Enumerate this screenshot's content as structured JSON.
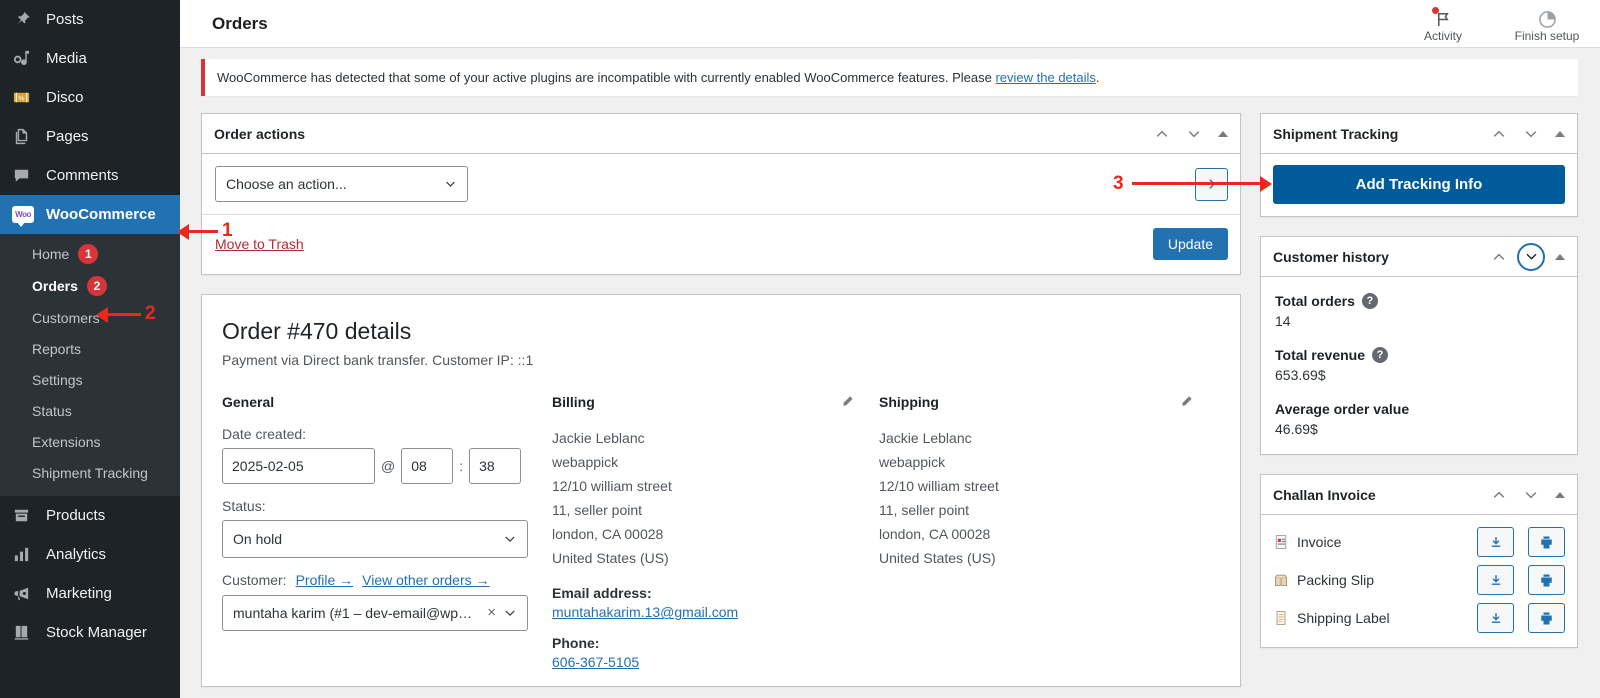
{
  "sidebar": {
    "items": [
      {
        "label": "Posts",
        "icon": "pin-icon",
        "current": false
      },
      {
        "label": "Media",
        "icon": "media-icon",
        "current": false
      },
      {
        "label": "Disco",
        "icon": "ticket-icon",
        "current": false
      },
      {
        "label": "Pages",
        "icon": "pages-icon",
        "current": false
      },
      {
        "label": "Comments",
        "icon": "comment-icon",
        "current": false
      },
      {
        "label": "WooCommerce",
        "icon": "woo-icon",
        "current": true
      },
      {
        "label": "Products",
        "icon": "products-icon",
        "current": false
      },
      {
        "label": "Analytics",
        "icon": "analytics-icon",
        "current": false
      },
      {
        "label": "Marketing",
        "icon": "megaphone-icon",
        "current": false
      },
      {
        "label": "Stock Manager",
        "icon": "stock-icon",
        "current": false
      }
    ],
    "submenu": [
      {
        "label": "Home",
        "count": "1",
        "current": false
      },
      {
        "label": "Orders",
        "count": "2",
        "current": true
      },
      {
        "label": "Customers",
        "count": "",
        "current": false
      },
      {
        "label": "Reports",
        "count": "",
        "current": false
      },
      {
        "label": "Settings",
        "count": "",
        "current": false
      },
      {
        "label": "Status",
        "count": "",
        "current": false
      },
      {
        "label": "Extensions",
        "count": "",
        "current": false
      },
      {
        "label": "Shipment Tracking",
        "count": "",
        "current": false
      }
    ]
  },
  "topbar": {
    "title": "Orders",
    "activity_label": "Activity",
    "finish_setup_label": "Finish setup"
  },
  "notice": {
    "text": "WooCommerce has detected that some of your active plugins are incompatible with currently enabled WooCommerce features. Please ",
    "link": "review the details",
    "suffix": "."
  },
  "order_actions": {
    "title": "Order actions",
    "action_select_value": "Choose an action...",
    "apply_arrow": "›",
    "trash_label": "Move to Trash",
    "update_label": "Update"
  },
  "order_details": {
    "heading": "Order #470 details",
    "subheading": "Payment via Direct bank transfer. Customer IP: ::1",
    "general": {
      "title": "General",
      "date_label": "Date created:",
      "date_value": "2025-02-05",
      "at_symbol": "@",
      "hour_value": "08",
      "colon": ":",
      "minute_value": "38",
      "status_label": "Status:",
      "status_value": "On hold",
      "customer_label": "Customer:",
      "profile_link": "Profile →",
      "other_orders_link": "View other orders →",
      "customer_value": "muntaha karim (#1 – dev-email@wp…",
      "clear_symbol": "×"
    },
    "billing": {
      "title": "Billing",
      "address": [
        "Jackie Leblanc",
        "webappick",
        "12/10 william street",
        "11, seller point",
        "london, CA 00028",
        "United States (US)"
      ],
      "email_label": "Email address:",
      "email_value": "muntahakarim.13@gmail.com",
      "phone_label": "Phone:",
      "phone_value": "606-367-5105"
    },
    "shipping": {
      "title": "Shipping",
      "address": [
        "Jackie Leblanc",
        "webappick",
        "12/10 william street",
        "11, seller point",
        "london, CA 00028",
        "United States (US)"
      ]
    }
  },
  "shipment_tracking": {
    "title": "Shipment Tracking",
    "add_button": "Add Tracking Info"
  },
  "customer_history": {
    "title": "Customer history",
    "rows": [
      {
        "label": "Total orders",
        "value": "14",
        "has_tip": true
      },
      {
        "label": "Total revenue",
        "value": "653.69$",
        "has_tip": true
      },
      {
        "label": "Average order value",
        "value": "46.69$",
        "has_tip": false
      }
    ]
  },
  "challan_invoice": {
    "title": "Challan Invoice",
    "rows": [
      {
        "label": "Invoice",
        "icon": "invoice-icon"
      },
      {
        "label": "Packing Slip",
        "icon": "package-icon"
      },
      {
        "label": "Shipping Label",
        "icon": "label-icon"
      }
    ],
    "download_icon": "download-icon",
    "print_icon": "print-icon"
  },
  "annotations": [
    {
      "number": "1"
    },
    {
      "number": "2"
    },
    {
      "number": "3"
    }
  ],
  "colors": {
    "accent_blue": "#2271b1",
    "button_blue": "#005b9a",
    "admin_dark": "#1d2327",
    "submenu_dark": "#2c3338",
    "danger_red": "#d63638",
    "annotation_red": "#e8291c",
    "trash_red": "#b32d2e"
  }
}
